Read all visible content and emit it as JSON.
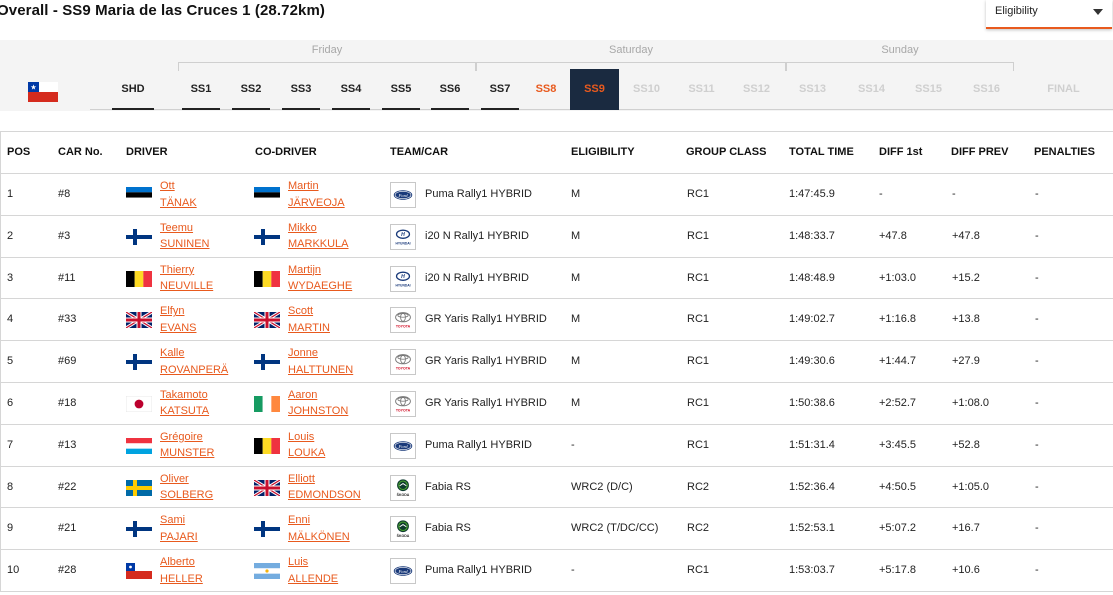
{
  "header": {
    "title": "Overall - SS9 Maria de las Cruces 1 (28.72km)",
    "eligibility_label": "Eligibility"
  },
  "days": [
    "Friday",
    "Saturday",
    "Sunday"
  ],
  "country_flag": "chile-flag",
  "tabs": [
    {
      "label": "SHD",
      "state": "done"
    },
    {
      "label": "SS1",
      "state": "done"
    },
    {
      "label": "SS2",
      "state": "done"
    },
    {
      "label": "SS3",
      "state": "done"
    },
    {
      "label": "SS4",
      "state": "done"
    },
    {
      "label": "SS5",
      "state": "done"
    },
    {
      "label": "SS6",
      "state": "done"
    },
    {
      "label": "SS7",
      "state": "done"
    },
    {
      "label": "SS8",
      "state": "prev"
    },
    {
      "label": "SS9",
      "state": "active"
    },
    {
      "label": "SS10",
      "state": "future"
    },
    {
      "label": "SS11",
      "state": "future"
    },
    {
      "label": "SS12",
      "state": "future"
    },
    {
      "label": "SS13",
      "state": "future"
    },
    {
      "label": "SS14",
      "state": "future"
    },
    {
      "label": "SS15",
      "state": "future"
    },
    {
      "label": "SS16",
      "state": "future"
    },
    {
      "label": "FINAL",
      "state": "future"
    }
  ],
  "colors": {
    "accent": "#e85a1e",
    "active_tab_bg": "#1a2a40"
  },
  "columns": [
    "POS",
    "CAR No.",
    "DRIVER",
    "CO-DRIVER",
    "TEAM/CAR",
    "ELIGIBILITY",
    "GROUP CLASS",
    "TOTAL TIME",
    "DIFF 1st",
    "DIFF PREV",
    "PENALTIES"
  ],
  "rows": [
    {
      "pos": "1",
      "car": "#8",
      "driver_first": "Ott",
      "driver_last": "TÄNAK",
      "driver_flag": "EST",
      "codriver_first": "Martin",
      "codriver_last": "JÄRVEOJA",
      "codriver_flag": "EST",
      "logo": "ford-logo",
      "team": "Puma Rally1 HYBRID",
      "elig": "M",
      "group": "RC1",
      "total": "1:47:45.9",
      "diff1": "-",
      "diffprev": "-",
      "pen": "-"
    },
    {
      "pos": "2",
      "car": "#3",
      "driver_first": "Teemu",
      "driver_last": "SUNINEN",
      "driver_flag": "FIN",
      "codriver_first": "Mikko",
      "codriver_last": "MARKKULA",
      "codriver_flag": "FIN",
      "logo": "hyundai-logo",
      "team": "i20 N Rally1 HYBRID",
      "elig": "M",
      "group": "RC1",
      "total": "1:48:33.7",
      "diff1": "+47.8",
      "diffprev": "+47.8",
      "pen": "-"
    },
    {
      "pos": "3",
      "car": "#11",
      "driver_first": "Thierry",
      "driver_last": "NEUVILLE",
      "driver_flag": "BEL",
      "codriver_first": "Martijn",
      "codriver_last": "WYDAEGHE",
      "codriver_flag": "BEL",
      "logo": "hyundai-logo",
      "team": "i20 N Rally1 HYBRID",
      "elig": "M",
      "group": "RC1",
      "total": "1:48:48.9",
      "diff1": "+1:03.0",
      "diffprev": "+15.2",
      "pen": "-"
    },
    {
      "pos": "4",
      "car": "#33",
      "driver_first": "Elfyn",
      "driver_last": "EVANS",
      "driver_flag": "GBR",
      "codriver_first": "Scott",
      "codriver_last": "MARTIN",
      "codriver_flag": "GBR",
      "logo": "toyota-logo",
      "team": "GR Yaris Rally1 HYBRID",
      "elig": "M",
      "group": "RC1",
      "total": "1:49:02.7",
      "diff1": "+1:16.8",
      "diffprev": "+13.8",
      "pen": "-"
    },
    {
      "pos": "5",
      "car": "#69",
      "driver_first": "Kalle",
      "driver_last": "ROVANPERÄ",
      "driver_flag": "FIN",
      "codriver_first": "Jonne",
      "codriver_last": "HALTTUNEN",
      "codriver_flag": "FIN",
      "logo": "toyota-logo",
      "team": "GR Yaris Rally1 HYBRID",
      "elig": "M",
      "group": "RC1",
      "total": "1:49:30.6",
      "diff1": "+1:44.7",
      "diffprev": "+27.9",
      "pen": "-"
    },
    {
      "pos": "6",
      "car": "#18",
      "driver_first": "Takamoto",
      "driver_last": "KATSUTA",
      "driver_flag": "JPN",
      "codriver_first": "Aaron",
      "codriver_last": "JOHNSTON",
      "codriver_flag": "IRL",
      "logo": "toyota-logo",
      "team": "GR Yaris Rally1 HYBRID",
      "elig": "M",
      "group": "RC1",
      "total": "1:50:38.6",
      "diff1": "+2:52.7",
      "diffprev": "+1:08.0",
      "pen": "-"
    },
    {
      "pos": "7",
      "car": "#13",
      "driver_first": "Grégoire",
      "driver_last": "MUNSTER",
      "driver_flag": "LUX",
      "codriver_first": "Louis",
      "codriver_last": "LOUKA",
      "codriver_flag": "BEL",
      "logo": "ford-logo",
      "team": "Puma Rally1 HYBRID",
      "elig": "-",
      "group": "RC1",
      "total": "1:51:31.4",
      "diff1": "+3:45.5",
      "diffprev": "+52.8",
      "pen": "-"
    },
    {
      "pos": "8",
      "car": "#22",
      "driver_first": "Oliver",
      "driver_last": "SOLBERG",
      "driver_flag": "SWE",
      "codriver_first": "Elliott",
      "codriver_last": "EDMONDSON",
      "codriver_flag": "GBR",
      "logo": "skoda-logo",
      "team": "Fabia RS",
      "elig": "WRC2 (D/C)",
      "group": "RC2",
      "total": "1:52:36.4",
      "diff1": "+4:50.5",
      "diffprev": "+1:05.0",
      "pen": "-"
    },
    {
      "pos": "9",
      "car": "#21",
      "driver_first": "Sami",
      "driver_last": "PAJARI",
      "driver_flag": "FIN",
      "codriver_first": "Enni",
      "codriver_last": "MÄLKÖNEN",
      "codriver_flag": "FIN",
      "logo": "skoda-logo",
      "team": "Fabia RS",
      "elig": "WRC2 (T/DC/CC)",
      "group": "RC2",
      "total": "1:52:53.1",
      "diff1": "+5:07.2",
      "diffprev": "+16.7",
      "pen": "-"
    },
    {
      "pos": "10",
      "car": "#28",
      "driver_first": "Alberto",
      "driver_last": "HELLER",
      "driver_flag": "CHL",
      "codriver_first": "Luis",
      "codriver_last": "ALLENDE",
      "codriver_flag": "ARG",
      "logo": "ford-logo",
      "team": "Puma Rally1 HYBRID",
      "elig": "-",
      "group": "RC1",
      "total": "1:53:03.7",
      "diff1": "+5:17.8",
      "diffprev": "+10.6",
      "pen": "-"
    }
  ]
}
